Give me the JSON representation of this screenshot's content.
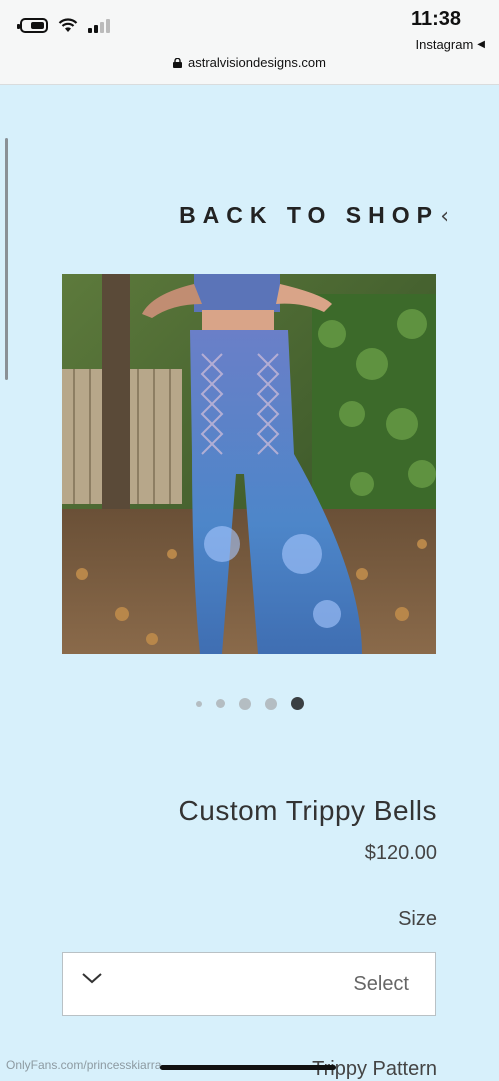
{
  "status": {
    "time": "11:38",
    "back_app": "Instagram",
    "url": "astralvisiondesigns.com",
    "battery_level": 0.65
  },
  "nav": {
    "back_to_shop": "BACK TO SHOP"
  },
  "gallery": {
    "slide_count": 5,
    "active_index": 4,
    "image_alt_icon": "product-photo"
  },
  "product": {
    "title": "Custom Trippy Bells",
    "price": "$120.00",
    "size_label": "Size",
    "size_select": "Select",
    "pattern_label": "Trippy Pattern"
  },
  "watermark": "OnlyFans.com/princesskiarra",
  "colors": {
    "page_bg": "#d7f0fb",
    "topbar_bg": "#f6f7f7",
    "active_dot": "#3a3f42",
    "inactive_dot": "#b4bdc2"
  }
}
